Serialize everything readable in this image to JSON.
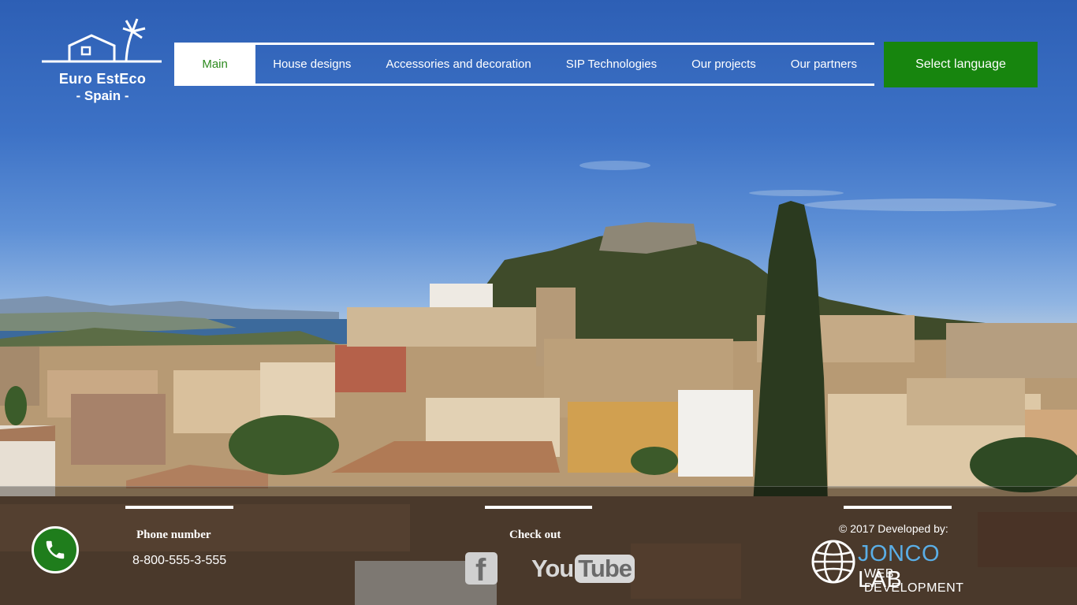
{
  "logo": {
    "name": "Euro EstEco",
    "country": "- Spain -"
  },
  "nav": {
    "items": [
      {
        "label": "Main",
        "active": true
      },
      {
        "label": "House designs"
      },
      {
        "label": "Accessories and decoration"
      },
      {
        "label": "SIP Technologies"
      },
      {
        "label": "Our projects"
      },
      {
        "label": "Our partners"
      }
    ]
  },
  "language_button": "Select language",
  "footer": {
    "phone": {
      "label": "Phone number",
      "number": "8-800-555-3-555",
      "icon": "phone-icon"
    },
    "social": {
      "label": "Check out",
      "facebook_icon": "f",
      "youtube_you": "You",
      "youtube_tube": "Tube"
    },
    "developer": {
      "label": "© 2017 Developed by:",
      "name_part1": "JONCO",
      "name_part2": " LAB",
      "subtitle": "WEB DEVELOPMENT"
    }
  },
  "colors": {
    "accent_green": "#17850e",
    "nav_active_text": "#2d8a1f",
    "jonco_blue": "#5aaee6"
  }
}
